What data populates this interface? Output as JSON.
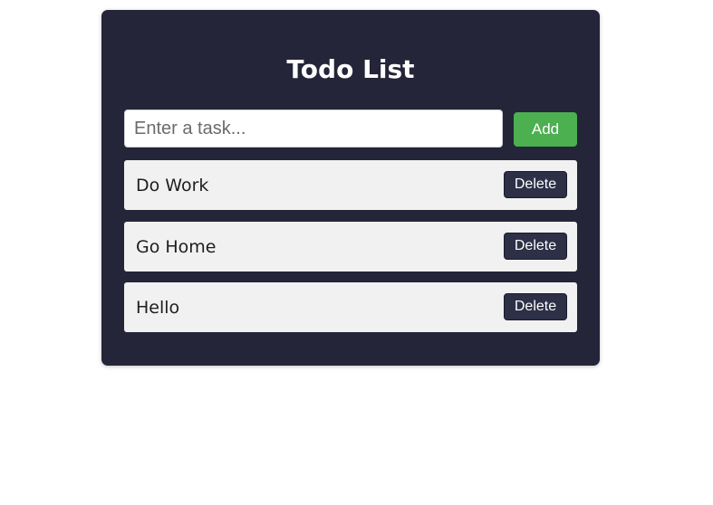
{
  "colors": {
    "card_background": "#242538",
    "add_button": "#4caf50",
    "delete_button": "#2d3047",
    "item_background": "#f1f1f1"
  },
  "app": {
    "title": "Todo List"
  },
  "form": {
    "input_value": "",
    "input_placeholder": "Enter a task...",
    "add_label": "Add"
  },
  "todos": [
    {
      "text": "Do Work",
      "delete_label": "Delete"
    },
    {
      "text": "Go Home",
      "delete_label": "Delete"
    },
    {
      "text": "Hello",
      "delete_label": "Delete"
    }
  ]
}
